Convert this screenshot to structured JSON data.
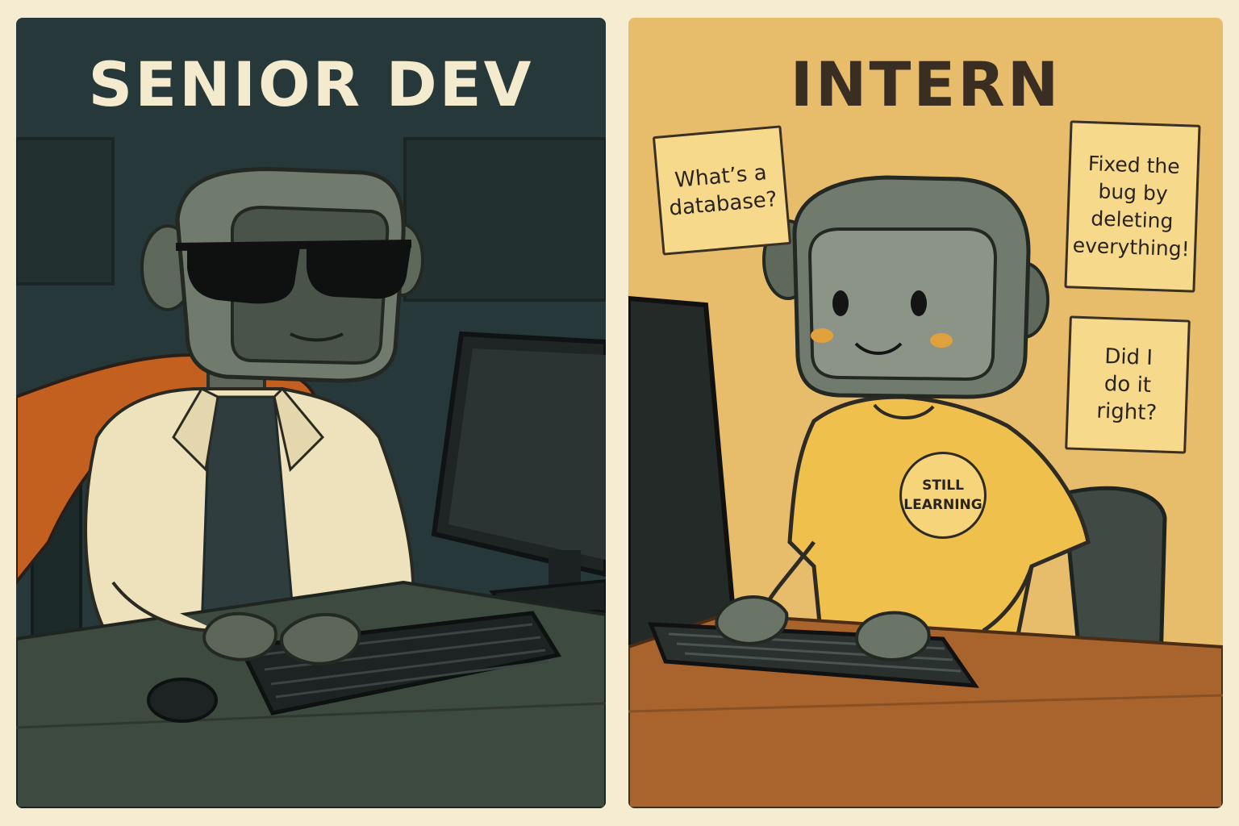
{
  "senior_panel": {
    "title": "SENIOR DEV"
  },
  "intern_panel": {
    "title": "INTERN",
    "sticky_notes": [
      {
        "text": "What’s a\ndatabase?"
      },
      {
        "text": "Fixed the\nbug by\ndeleting\neverything!"
      },
      {
        "text": "Did I\ndo it\nright?"
      }
    ],
    "shirt_badge": "STILL\nLEARNING"
  },
  "colors": {
    "page_background": "#f6ecd2",
    "senior_background": "#26383a",
    "intern_background": "#e7bc6b",
    "robot_gray": "#6f7a6c",
    "cape_orange": "#c4601f",
    "lab_coat": "#ede2bb",
    "intern_shirt": "#f0c04c"
  },
  "icons": [
    "sunglasses-icon",
    "cape-icon",
    "keyboard-icon",
    "mouse-icon",
    "monitor-icon"
  ]
}
